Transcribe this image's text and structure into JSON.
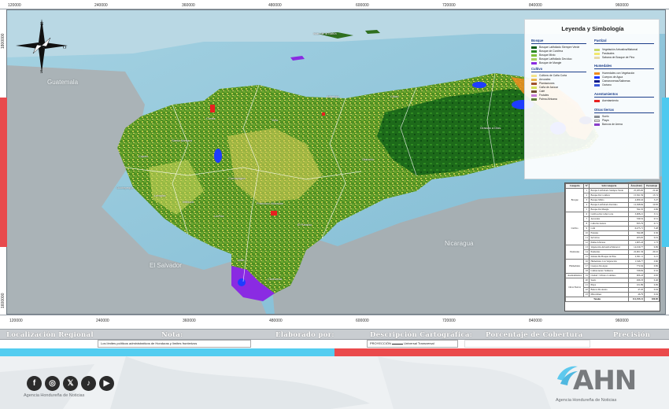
{
  "coordinates": {
    "top": [
      "120000",
      "240000",
      "360000",
      "480000",
      "600000",
      "720000",
      "840000",
      "960000"
    ],
    "bottom": [
      "120000",
      "240000",
      "360000",
      "480000",
      "600000",
      "720000",
      "840000",
      "960000"
    ],
    "left": [
      "1800000",
      "1600000"
    ]
  },
  "map": {
    "countries": {
      "guatemala": "Guatemala",
      "el_salvador": "El Salvador",
      "nicaragua": "Nicaragua"
    },
    "departments": [
      "Colón",
      "Atlántida",
      "Cortés",
      "Yoro",
      "Olancho",
      "Gracias a Dios",
      "Santa Bárbara",
      "Copán",
      "Ocotepeque",
      "Lempira",
      "Intibucá",
      "Comayagua",
      "Francisco Morazán",
      "El Paraíso",
      "La Paz",
      "Valle",
      "Choluteca",
      "Islas de la Bahía"
    ]
  },
  "legend": {
    "title": "Leyenda y Simbología",
    "bosque": {
      "heading": "Bosque",
      "items": [
        {
          "label": "Bosque Latifoliado Siempre Verde",
          "color": "#0b5b18"
        },
        {
          "label": "Bosque de Conífera",
          "color": "#2e8b22"
        },
        {
          "label": "Bosque Mixto",
          "color": "#7fbf3a"
        },
        {
          "label": "Bosque Latifoliado Decíduo",
          "color": "#a8d060"
        },
        {
          "label": "Bosque de Mangle",
          "color": "#8a2be2"
        }
      ]
    },
    "cultivo": {
      "heading": "Cultivo",
      "items": [
        {
          "label": "Cultivos de Caña Corta",
          "color": "#f4e38a"
        },
        {
          "label": "Arrozales",
          "color": "#e8b34a"
        },
        {
          "label": "Plantaciones",
          "color": "#a0522d"
        },
        {
          "label": "Caña de Azúcar",
          "color": "#d4e05a"
        },
        {
          "label": "Café",
          "color": "#6d4c2f"
        },
        {
          "label": "Frutales",
          "color": "#c77dd9"
        },
        {
          "label": "Palma Africana",
          "color": "#5f7f3b"
        }
      ]
    },
    "pastizal": {
      "heading": "Pastizal",
      "items": [
        {
          "label": "Vegetación Arbustiva/Matorral",
          "color": "#c8d96b"
        },
        {
          "label": "Pastizales",
          "color": "#f2e86e"
        },
        {
          "label": "Sabana de Bosque de Pino",
          "color": "#e6d9a8"
        }
      ]
    },
    "humedales": {
      "heading": "Humedales",
      "items": [
        {
          "label": "Humedales con Vegetación",
          "color": "#f08c1e"
        },
        {
          "label": "Cuerpos de Agua",
          "color": "#1e3cff"
        },
        {
          "label": "Camaroneras/Salineras",
          "color": "#0a1a8a"
        },
        {
          "label": "Océano",
          "color": "#3a57d8"
        }
      ]
    },
    "asentamientos": {
      "heading": "Asentamientos",
      "items": [
        {
          "label": "Asentamiento",
          "color": "#e8201f"
        }
      ]
    },
    "otras": {
      "heading": "Otras tierras",
      "items": [
        {
          "label": "Suelo",
          "color": "#8a8f96"
        },
        {
          "label": "Playa",
          "color": "#f0f0e6"
        },
        {
          "label": "Bancos de Arena",
          "color": "#8a3dc9"
        }
      ]
    }
  },
  "table": {
    "headers": [
      "Categoría",
      "N°",
      "Sub-Categoría",
      "Área (Km²)",
      "Porcentaje"
    ],
    "rows": [
      {
        "cat": "Bosque",
        "span": 5,
        "n": "1",
        "sub": "Bosque Latifoliado Siempre Verde",
        "area": "25,283.00",
        "pct": "22.46"
      },
      {
        "cat": "",
        "n": "2",
        "sub": "Bosque De Conífera",
        "area": "15,561.59",
        "pct": "13.74"
      },
      {
        "cat": "",
        "n": "3",
        "sub": "Bosque Mixto",
        "area": "4,009.42",
        "pct": "3.47"
      },
      {
        "cat": "",
        "n": "4",
        "sub": "Bosque Latifoliado Decíduo",
        "area": "12,368.84",
        "pct": "10.83"
      },
      {
        "cat": "",
        "n": "5",
        "sub": "Bosque De Mangle",
        "area": "592.35",
        "pct": "0.69"
      },
      {
        "cat": "Cultivo",
        "span": 7,
        "n": "6",
        "sub": "Cultivos De Caña Corta",
        "area": "3,908.21",
        "pct": "3.51"
      },
      {
        "cat": "",
        "n": "7",
        "sub": "Arrozales",
        "area": "539.52",
        "pct": "0.51"
      },
      {
        "cat": "",
        "n": "8",
        "sub": "Caña De Azúcar",
        "area": "833.79",
        "pct": "0.71"
      },
      {
        "cat": "",
        "n": "9",
        "sub": "Café",
        "area": "6,475.71",
        "pct": "5.48"
      },
      {
        "cat": "",
        "n": "10",
        "sub": "Frutales",
        "area": "394.98",
        "pct": "0.36"
      },
      {
        "cat": "",
        "n": "11",
        "sub": "Servicios",
        "area": "203.05",
        "pct": "0.19"
      },
      {
        "cat": "",
        "n": "12",
        "sub": "Palma Africana",
        "area": "1,905.43",
        "pct": "1.73"
      },
      {
        "cat": "Pastizales",
        "span": 3,
        "n": "13",
        "sub": "Vegetación Arbustiva/Matorral",
        "area": "14,019.77",
        "pct": "9.99"
      },
      {
        "cat": "",
        "n": "14",
        "sub": "Pastizales",
        "area": "22,601.56",
        "pct": "20.16"
      },
      {
        "cat": "",
        "n": "15",
        "sub": "Sabana De Bosque de Pino",
        "area": "2,301.11",
        "pct": "2.21"
      },
      {
        "cat": "Humedales",
        "span": 3,
        "n": "16",
        "sub": "Humedales Con Vegetación",
        "area": "1,346.77",
        "pct": "0.66"
      },
      {
        "cat": "",
        "n": "17",
        "sub": "Cuerpos De Agua",
        "area": "772.94",
        "pct": "0.69"
      },
      {
        "cat": "",
        "n": "18",
        "sub": "Camaroneras/ Salineras",
        "area": "336.84",
        "pct": "0.32"
      },
      {
        "cat": "Asentamientos",
        "span": 1,
        "n": "19",
        "sub": "Ciudad / Urbano Continuo",
        "area": "906.43",
        "pct": "0.83"
      },
      {
        "cat": "Otras Tierras",
        "span": 4,
        "n": "20",
        "sub": "Suelo",
        "area": "496.33",
        "pct": "0.46"
      },
      {
        "cat": "",
        "n": "21",
        "sub": "Playa",
        "area": "101.89",
        "pct": "0.09"
      },
      {
        "cat": "",
        "n": "22",
        "sub": "Bancos De Arena",
        "area": "47.20",
        "pct": "0.04"
      },
      {
        "cat": "",
        "n": "23",
        "sub": "Miscelánea",
        "area": "46.79",
        "pct": "0.04"
      }
    ],
    "total_label": "Totales",
    "total_area": "112,355.12",
    "total_pct": "100.00"
  },
  "info_bar": {
    "headings": [
      "Localización Regional",
      "Nota:",
      "Elaborado por:",
      "Descripción Cartográfica:",
      "Porcentaje de Cobertura",
      "Precisión"
    ],
    "note_text": "Los límites políticos administrativos de Honduras y límites fronterizos",
    "projection_label": "PROYECCIÓN",
    "projection_value": "Universal Transversal"
  },
  "footer": {
    "agency_small": "Agencia Hondureña de Noticias",
    "logo_text": "AHN",
    "logo_sub": "Agencia Hondureña de Noticias",
    "social_icons": [
      "facebook-icon",
      "instagram-icon",
      "x-icon",
      "tiktok-icon",
      "youtube-icon"
    ],
    "social_glyphs": [
      "f",
      "◎",
      "𝕏",
      "♪",
      "▶"
    ]
  },
  "colors": {
    "ocean": "#8fc7dc",
    "land_bg": "#9da7ad",
    "accent_red": "#ea4a4c",
    "accent_cyan": "#54cdf0"
  }
}
